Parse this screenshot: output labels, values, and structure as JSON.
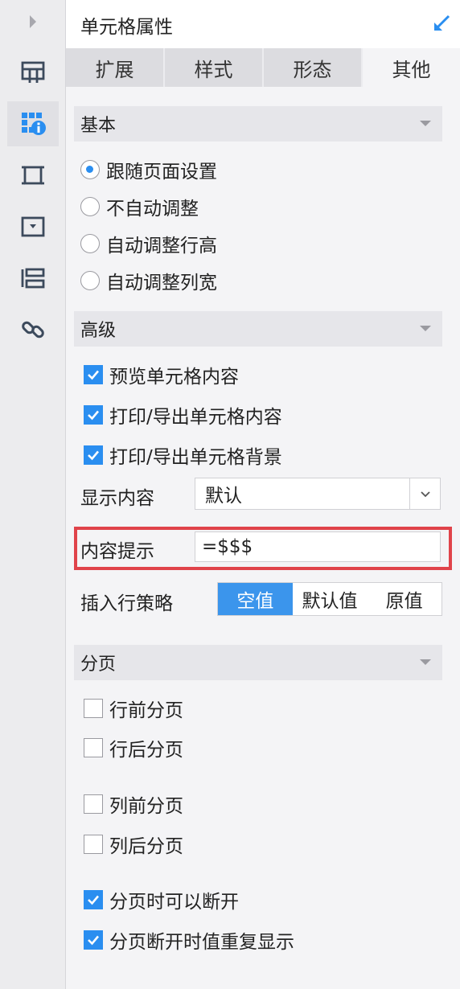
{
  "rail": {
    "icons": [
      "expand-arrow-icon",
      "cell-layout-icon",
      "cell-attribute-icon",
      "frame-icon",
      "widget-icon",
      "list-icon",
      "link-icon"
    ]
  },
  "panel": {
    "title": "单元格属性",
    "tabs": [
      {
        "label": "扩展",
        "active": false
      },
      {
        "label": "样式",
        "active": false
      },
      {
        "label": "形态",
        "active": false
      },
      {
        "label": "其他",
        "active": true
      }
    ]
  },
  "basic": {
    "title": "基本",
    "options": [
      {
        "label": "跟随页面设置",
        "checked": true
      },
      {
        "label": "不自动调整",
        "checked": false
      },
      {
        "label": "自动调整行高",
        "checked": false
      },
      {
        "label": "自动调整列宽",
        "checked": false
      }
    ]
  },
  "advanced": {
    "title": "高级",
    "checks": [
      {
        "label": "预览单元格内容",
        "checked": true
      },
      {
        "label": "打印/导出单元格内容",
        "checked": true
      },
      {
        "label": "打印/导出单元格背景",
        "checked": true
      }
    ],
    "display_label": "显示内容",
    "display_value": "默认",
    "hint_label": "内容提示",
    "hint_value": "=$$$",
    "insert_label": "插入行策略",
    "insert_options": [
      {
        "label": "空值",
        "active": true
      },
      {
        "label": "默认值",
        "active": false
      },
      {
        "label": "原值",
        "active": false
      }
    ]
  },
  "paging": {
    "title": "分页",
    "checks": [
      {
        "label": "行前分页",
        "checked": false
      },
      {
        "label": "行后分页",
        "checked": false
      },
      {
        "label": "列前分页",
        "checked": false
      },
      {
        "label": "列后分页",
        "checked": false
      },
      {
        "label": "分页时可以断开",
        "checked": true
      },
      {
        "label": "分页断开时值重复显示",
        "checked": true
      }
    ]
  },
  "colors": {
    "accent": "#2a8ef0",
    "highlight_border": "#e0434a"
  }
}
